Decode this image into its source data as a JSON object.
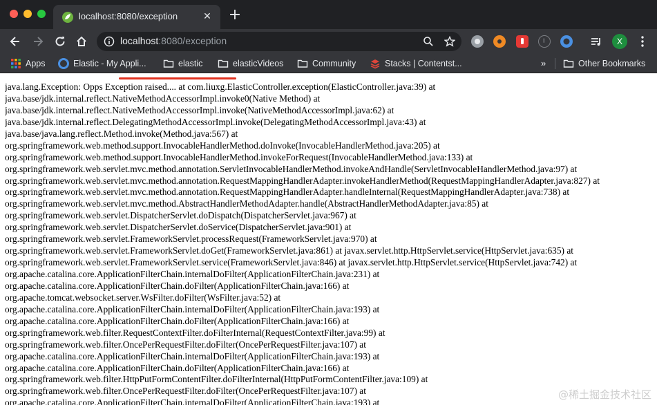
{
  "tab": {
    "title": "localhost:8080/exception",
    "close_glyph": "✕",
    "newtab_glyph": "+"
  },
  "address": {
    "host": "localhost",
    "rest": ":8080/exception"
  },
  "profile": {
    "initial": "X"
  },
  "bookmarks": {
    "items": [
      {
        "label": "Apps",
        "icon": "apps-grid-icon"
      },
      {
        "label": "Elastic - My Appli...",
        "icon": "elastic-icon"
      },
      {
        "label": "elastic",
        "icon": "folder-icon"
      },
      {
        "label": "elasticVideos",
        "icon": "folder-icon"
      },
      {
        "label": "Community",
        "icon": "folder-icon"
      },
      {
        "label": "Stacks | Contentst...",
        "icon": "contentstack-icon"
      }
    ],
    "more": "»",
    "other": "Other Bookmarks"
  },
  "stacktrace": [
    "java.lang.Exception: Opps Exception raised.... at com.liuxg.ElasticController.exception(ElasticController.java:39) at",
    "java.base/jdk.internal.reflect.NativeMethodAccessorImpl.invoke0(Native Method) at",
    "java.base/jdk.internal.reflect.NativeMethodAccessorImpl.invoke(NativeMethodAccessorImpl.java:62) at",
    "java.base/jdk.internal.reflect.DelegatingMethodAccessorImpl.invoke(DelegatingMethodAccessorImpl.java:43) at",
    "java.base/java.lang.reflect.Method.invoke(Method.java:567) at",
    "org.springframework.web.method.support.InvocableHandlerMethod.doInvoke(InvocableHandlerMethod.java:205) at",
    "org.springframework.web.method.support.InvocableHandlerMethod.invokeForRequest(InvocableHandlerMethod.java:133) at",
    "org.springframework.web.servlet.mvc.method.annotation.ServletInvocableHandlerMethod.invokeAndHandle(ServletInvocableHandlerMethod.java:97) at",
    "org.springframework.web.servlet.mvc.method.annotation.RequestMappingHandlerAdapter.invokeHandlerMethod(RequestMappingHandlerAdapter.java:827) at",
    "org.springframework.web.servlet.mvc.method.annotation.RequestMappingHandlerAdapter.handleInternal(RequestMappingHandlerAdapter.java:738) at",
    "org.springframework.web.servlet.mvc.method.AbstractHandlerMethodAdapter.handle(AbstractHandlerMethodAdapter.java:85) at",
    "org.springframework.web.servlet.DispatcherServlet.doDispatch(DispatcherServlet.java:967) at",
    "org.springframework.web.servlet.DispatcherServlet.doService(DispatcherServlet.java:901) at",
    "org.springframework.web.servlet.FrameworkServlet.processRequest(FrameworkServlet.java:970) at",
    "org.springframework.web.servlet.FrameworkServlet.doGet(FrameworkServlet.java:861) at javax.servlet.http.HttpServlet.service(HttpServlet.java:635) at",
    "org.springframework.web.servlet.FrameworkServlet.service(FrameworkServlet.java:846) at javax.servlet.http.HttpServlet.service(HttpServlet.java:742) at",
    "org.apache.catalina.core.ApplicationFilterChain.internalDoFilter(ApplicationFilterChain.java:231) at",
    "org.apache.catalina.core.ApplicationFilterChain.doFilter(ApplicationFilterChain.java:166) at",
    "org.apache.tomcat.websocket.server.WsFilter.doFilter(WsFilter.java:52) at",
    "org.apache.catalina.core.ApplicationFilterChain.internalDoFilter(ApplicationFilterChain.java:193) at",
    "org.apache.catalina.core.ApplicationFilterChain.doFilter(ApplicationFilterChain.java:166) at",
    "org.springframework.web.filter.RequestContextFilter.doFilterInternal(RequestContextFilter.java:99) at",
    "org.springframework.web.filter.OncePerRequestFilter.doFilter(OncePerRequestFilter.java:107) at",
    "org.apache.catalina.core.ApplicationFilterChain.internalDoFilter(ApplicationFilterChain.java:193) at",
    "org.apache.catalina.core.ApplicationFilterChain.doFilter(ApplicationFilterChain.java:166) at",
    "org.springframework.web.filter.HttpPutFormContentFilter.doFilterInternal(HttpPutFormContentFilter.java:109) at",
    "org.springframework.web.filter.OncePerRequestFilter.doFilter(OncePerRequestFilter.java:107) at",
    "org.apache.catalina.core.ApplicationFilterChain.internalDoFilter(ApplicationFilterChain.java:193) at"
  ],
  "watermark": "@稀土掘金技术社区"
}
